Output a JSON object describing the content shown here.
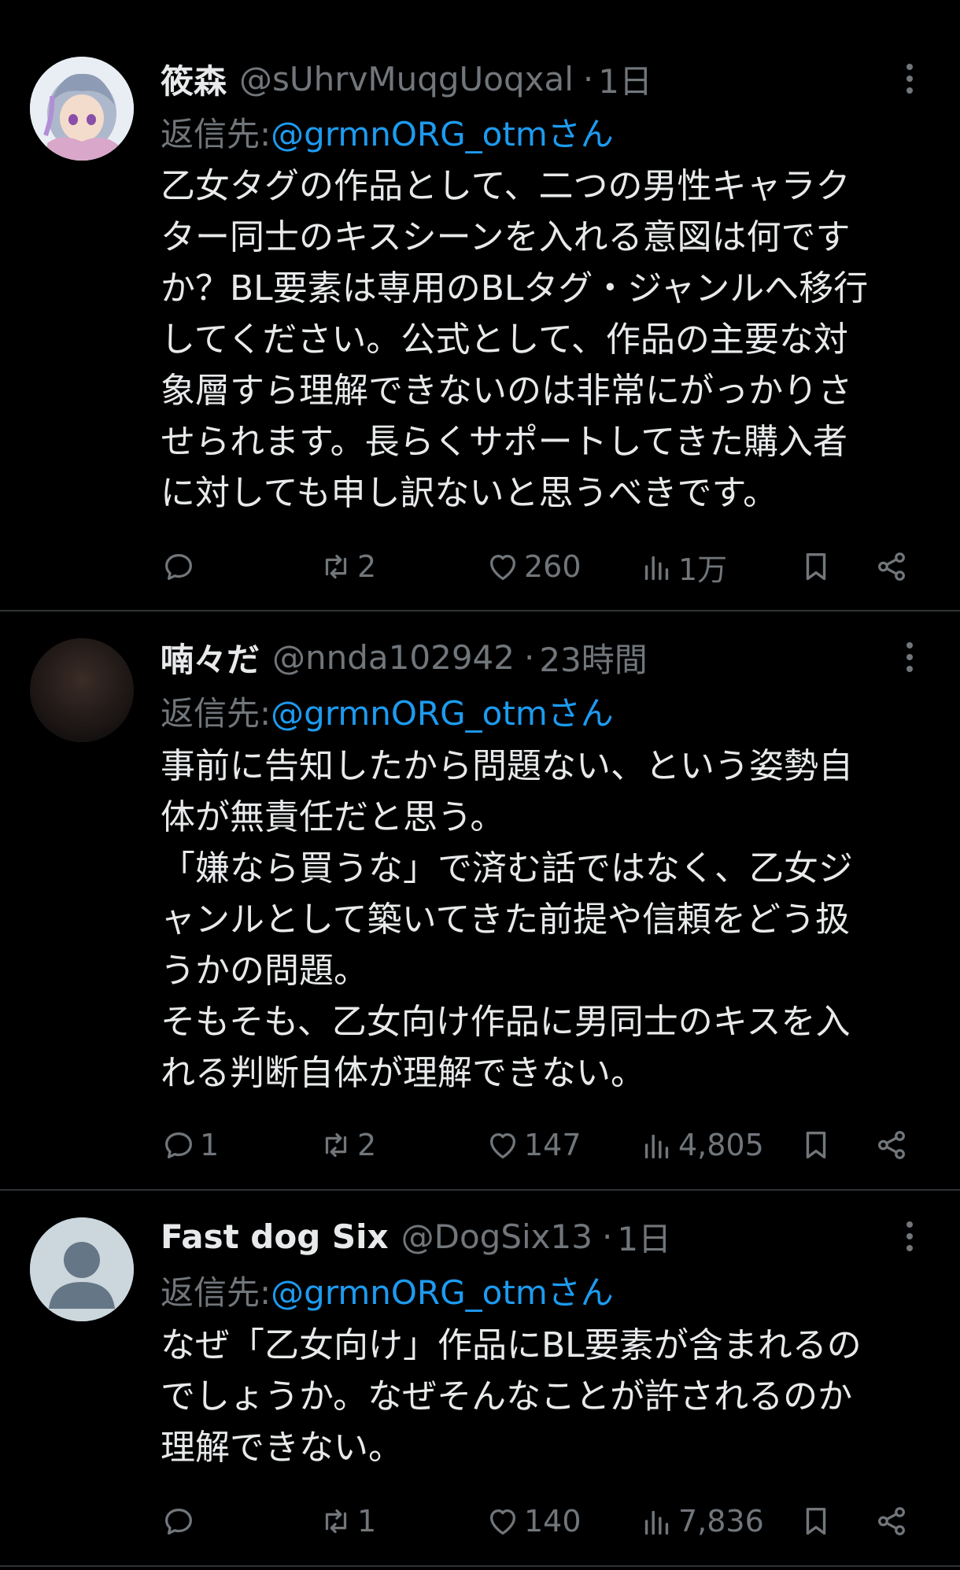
{
  "tweets": [
    {
      "name": "筱森",
      "handle": "@sUhrvMuqgUoqxal",
      "time": "1日",
      "reply_label": "返信先: ",
      "reply_mention": "@grmnORG_otmさん",
      "lines": [
        "乙女タグの作品として、二つの男性キャラク",
        "ター同士のキスシーンを入れる意図は何です",
        "か？BL要素は専用のBLタグ・ジャンルへ移行",
        "してください。公式として、作品の主要な対",
        "象層すら理解できないのは非常にがっかりさ",
        "せられます。長らくサポートしてきた購入者",
        "に対しても申し訳ないと思うべきです。"
      ],
      "replies": "",
      "retweets": "2",
      "likes": "260",
      "views": "1万",
      "avatar_color": "#d8e2ec"
    },
    {
      "name": "喃々だ",
      "handle": "@nnda102942",
      "time": "23時間",
      "reply_label": "返信先: ",
      "reply_mention": "@grmnORG_otmさん",
      "lines": [
        "事前に告知したから問題ない、という姿勢自",
        "体が無責任だと思う。",
        "「嫌なら買うな」で済む話ではなく、乙女ジ",
        "ャンルとして築いてきた前提や信頼をどう扱",
        "うかの問題。",
        "そもそも、乙女向け作品に男同士のキスを入",
        "れる判断自体が理解できない。"
      ],
      "replies": "1",
      "retweets": "2",
      "likes": "147",
      "views": "4,805",
      "avatar_color": "#2a1f1c"
    },
    {
      "name": "Fast dog Six",
      "handle": "@DogSix13",
      "time": "1日",
      "reply_label": "返信先: ",
      "reply_mention": "@grmnORG_otmさん",
      "lines": [
        "なぜ「乙女向け」作品にBL要素が含まれるの",
        "でしょうか。なぜそんなことが許されるのか",
        "理解できない。"
      ],
      "replies": "",
      "retweets": "1",
      "likes": "140",
      "views": "7,836",
      "avatar_color": "#ccd6dd"
    }
  ],
  "separator": "·",
  "colors": {
    "background": "#000000",
    "text": "#e7e9ea",
    "muted": "#71767b",
    "link": "#1d9bf0",
    "divider": "#2f3336"
  },
  "icons": [
    "reply-icon",
    "retweet-icon",
    "like-icon",
    "views-icon",
    "bookmark-icon",
    "share-icon",
    "more-icon"
  ]
}
